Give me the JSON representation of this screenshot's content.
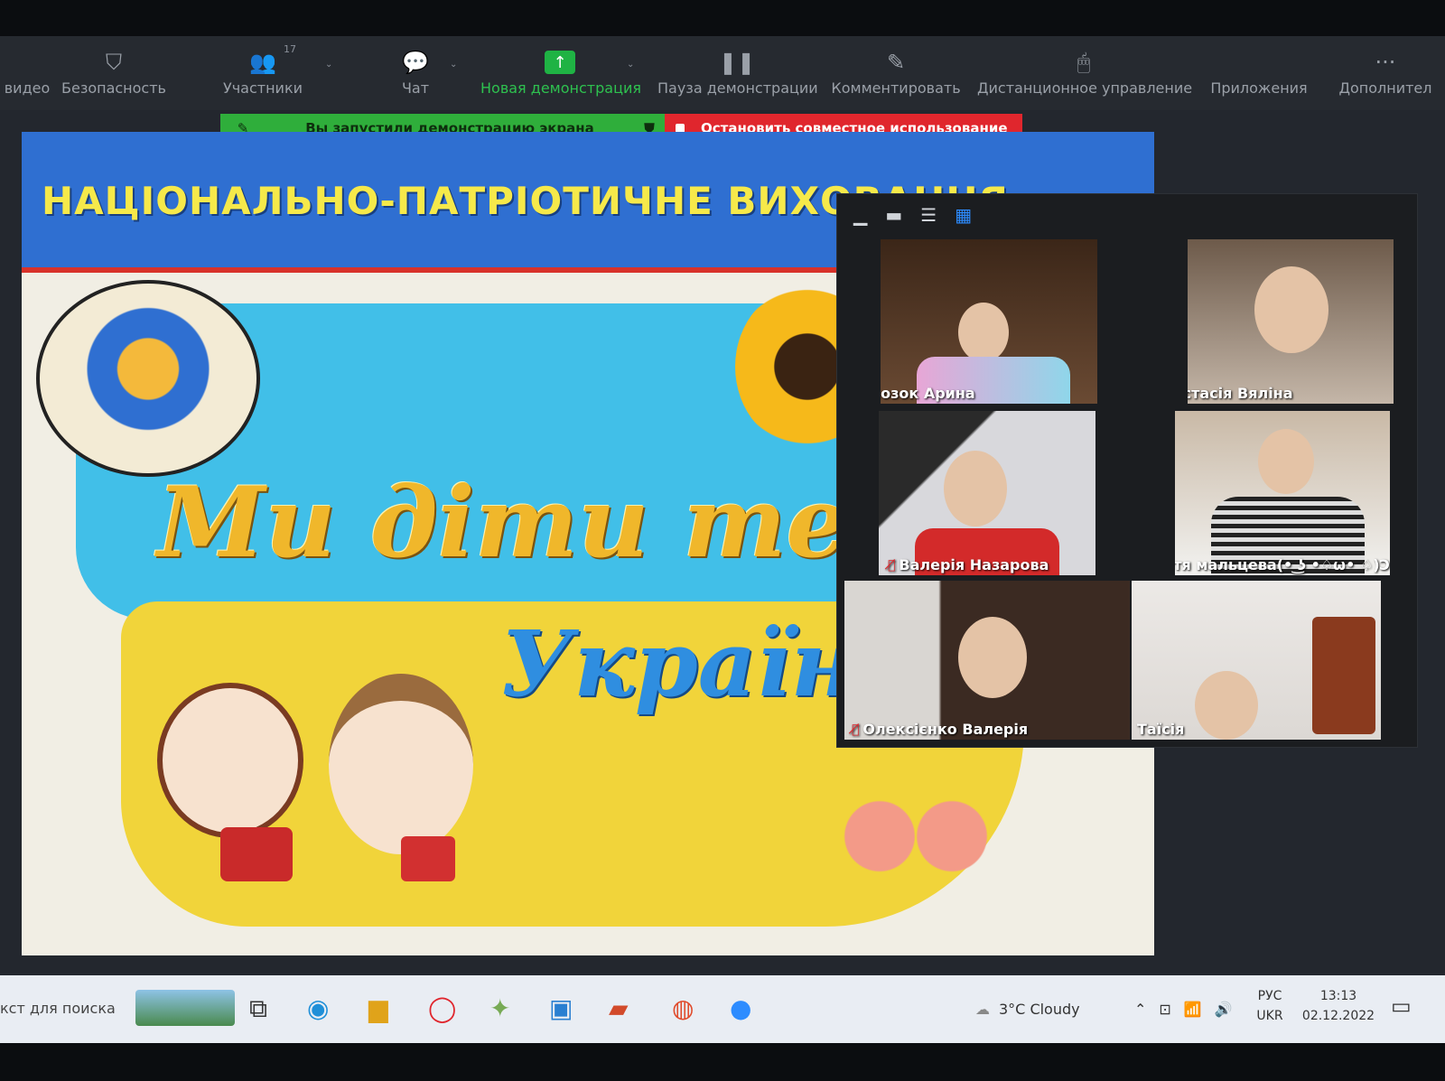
{
  "toolbar": {
    "video_label": "видео",
    "security_label": "Безопасность",
    "participants_label": "Участники",
    "participants_count": "17",
    "chat_label": "Чат",
    "new_share_label": "Новая демонстрация",
    "pause_share_label": "Пауза демонстрации",
    "annotate_label": "Комментировать",
    "remote_control_label": "Дистанционное управление",
    "apps_label": "Приложения",
    "more_label": "Дополнител"
  },
  "share_banner": {
    "status_text": "Вы запустили демонстрацию экрана",
    "stop_text": "Остановить совместное использование"
  },
  "slide": {
    "title": "НАЦІОНАЛЬНО-ПАТРІОТИЧНЕ ВИХОВАННЯ",
    "slogan_line1": "Ми діти те",
    "slogan_line2": "Україн"
  },
  "gallery": {
    "participants": [
      {
        "name": "Полозок Арина",
        "muted": false
      },
      {
        "name": "Анастасія Вяліна",
        "muted": true
      },
      {
        "name": "Валерія Назарова",
        "muted": true
      },
      {
        "name": "Катя мальцева(• ͜ʖ •♤ω• ♤)Ͻ",
        "muted": true
      },
      {
        "name": "Олексієнко Валерія",
        "muted": true
      },
      {
        "name": "Таїсія",
        "muted": false
      }
    ]
  },
  "taskbar": {
    "search_placeholder": "кст для поиска",
    "weather": "3°C  Cloudy",
    "lang_top": "РУС",
    "lang_bottom": "UKR",
    "time": "13:13",
    "date": "02.12.2022"
  },
  "colors": {
    "zoom_green": "#2ec14f",
    "stop_red": "#e0262d",
    "toolbar_bg": "#262a30",
    "active_blue": "#2d8cff"
  }
}
